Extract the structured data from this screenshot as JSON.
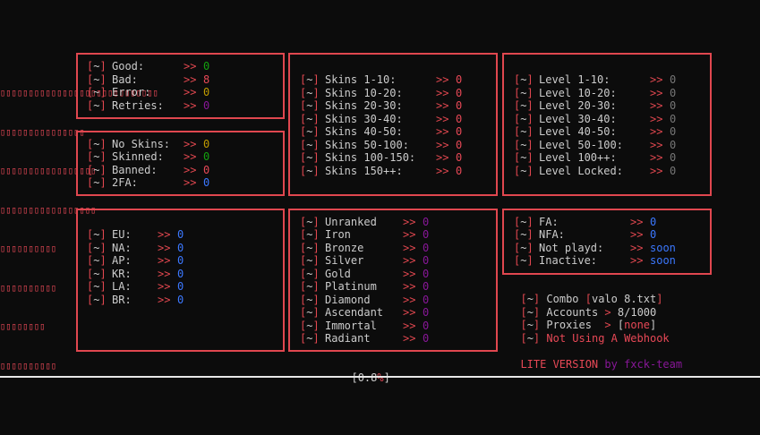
{
  "logo": {
    "lines": [
      "▯▯▯▯▯▯▯▯▯▯▯▯▯▯▯▯▯▯▯▯▯▯▯▯▯▯▯▯",
      "▯▯▯▯▯▯▯▯▯▯▯▯▯▯▯",
      "▯▯▯▯▯▯▯▯▯▯▯▯▯▯▯▯▯",
      "▯▯▯▯▯▯▯▯▯▯▯▯▯▯▯▯▯",
      "▯▯▯▯▯▯▯▯▯▯",
      "▯▯▯▯▯▯▯▯▯▯",
      "▯▯▯▯▯▯▯▯",
      "▯▯▯▯▯▯▯▯▯▯"
    ]
  },
  "bracket": "[~]",
  "arrow": ">>",
  "colors": {
    "border": "#e0474f",
    "green": "#13a10e",
    "red": "#e74856",
    "yellow": "#c19c00",
    "purple": "#881798",
    "blue": "#3b78ff",
    "gray": "#767676"
  },
  "stats": [
    {
      "label": "Good:",
      "value": "0",
      "color": "green"
    },
    {
      "label": "Bad:",
      "value": "8",
      "color": "red"
    },
    {
      "label": "Error:",
      "value": "0",
      "color": "yellow"
    },
    {
      "label": "Retries:",
      "value": "0",
      "color": "purple"
    }
  ],
  "status": [
    {
      "label": "No Skins:",
      "value": "0",
      "color": "yellow"
    },
    {
      "label": "Skinned:",
      "value": "0",
      "color": "green"
    },
    {
      "label": "Banned:",
      "value": "0",
      "color": "red"
    },
    {
      "label": "2FA:",
      "value": "0",
      "color": "blue"
    }
  ],
  "skins": [
    {
      "label": "Skins 1-10:",
      "value": "0"
    },
    {
      "label": "Skins 10-20:",
      "value": "0"
    },
    {
      "label": "Skins 20-30:",
      "value": "0"
    },
    {
      "label": "Skins 30-40:",
      "value": "0"
    },
    {
      "label": "Skins 40-50:",
      "value": "0"
    },
    {
      "label": "Skins 50-100:",
      "value": "0"
    },
    {
      "label": "Skins 100-150:",
      "value": "0"
    },
    {
      "label": "Skins 150++:",
      "value": "0"
    }
  ],
  "levels": [
    {
      "label": "Level 1-10:",
      "value": "0"
    },
    {
      "label": "Level 10-20:",
      "value": "0"
    },
    {
      "label": "Level 20-30:",
      "value": "0"
    },
    {
      "label": "Level 30-40:",
      "value": "0"
    },
    {
      "label": "Level 40-50:",
      "value": "0"
    },
    {
      "label": "Level 50-100:",
      "value": "0"
    },
    {
      "label": "Level 100++:",
      "value": "0"
    },
    {
      "label": "Level Locked:",
      "value": "0"
    }
  ],
  "regions": [
    {
      "label": "EU:",
      "value": "0"
    },
    {
      "label": "NA:",
      "value": "0"
    },
    {
      "label": "AP:",
      "value": "0"
    },
    {
      "label": "KR:",
      "value": "0"
    },
    {
      "label": "LA:",
      "value": "0"
    },
    {
      "label": "BR:",
      "value": "0"
    }
  ],
  "ranks": [
    {
      "label": "Unranked",
      "value": "0"
    },
    {
      "label": "Iron",
      "value": "0"
    },
    {
      "label": "Bronze",
      "value": "0"
    },
    {
      "label": "Silver",
      "value": "0"
    },
    {
      "label": "Gold",
      "value": "0"
    },
    {
      "label": "Platinum",
      "value": "0"
    },
    {
      "label": "Diamond",
      "value": "0"
    },
    {
      "label": "Ascendant",
      "value": "0"
    },
    {
      "label": "Immortal",
      "value": "0"
    },
    {
      "label": "Radiant",
      "value": "0"
    }
  ],
  "access": [
    {
      "label": "FA:",
      "value": "0"
    },
    {
      "label": "NFA:",
      "value": "0"
    },
    {
      "label": "Not playd:",
      "value": "soon"
    },
    {
      "label": "Inactive:",
      "value": "soon"
    }
  ],
  "info": {
    "combo_label": "Combo",
    "combo_value": "valo 8.txt",
    "accounts_label": "Accounts",
    "accounts_sep": ">",
    "accounts_value": "8/1000",
    "proxies_label": "Proxies",
    "proxies_sep": ">",
    "proxies_value": "none",
    "webhook_text": "Not Using A Webhook",
    "version_text": "LITE VERSION",
    "by_text": "by",
    "team_text": "fxck-team"
  },
  "progress": {
    "prefix": "[",
    "value": "0.8",
    "unit": "%",
    "suffix": "]"
  }
}
